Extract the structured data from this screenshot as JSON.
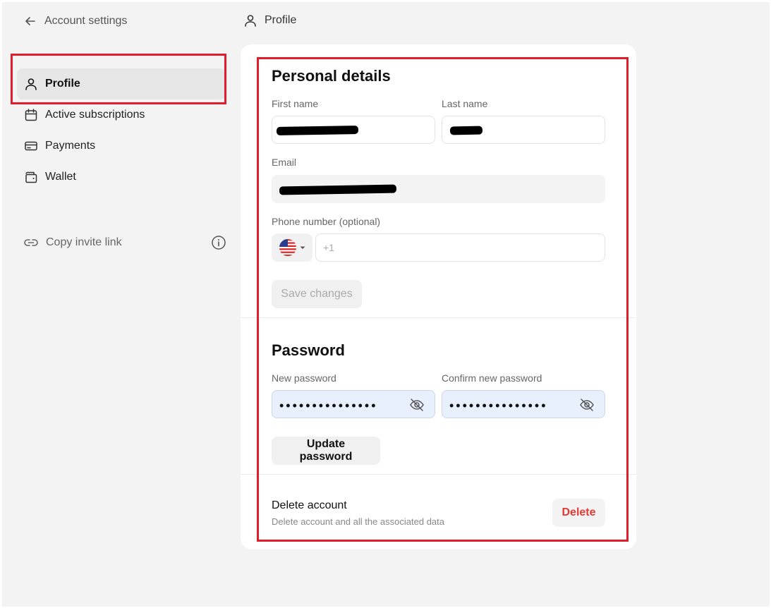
{
  "header": {
    "back_label": "Account settings",
    "breadcrumb": "Profile"
  },
  "sidebar": {
    "items": [
      {
        "label": "Profile",
        "icon": "user-icon",
        "active": true
      },
      {
        "label": "Active subscriptions",
        "icon": "calendar-icon",
        "active": false
      },
      {
        "label": "Payments",
        "icon": "credit-card-icon",
        "active": false
      },
      {
        "label": "Wallet",
        "icon": "wallet-icon",
        "active": false
      }
    ],
    "invite_label": "Copy invite link",
    "invite_icon": "link-icon",
    "info_icon": "info-icon"
  },
  "personal": {
    "title": "Personal details",
    "first_name_label": "First name",
    "last_name_label": "Last name",
    "email_label": "Email",
    "phone_label": "Phone number (optional)",
    "phone_placeholder": "+1",
    "country_flag": "us-flag-icon",
    "save_label": "Save changes"
  },
  "password": {
    "title": "Password",
    "new_label": "New password",
    "confirm_label": "Confirm new password",
    "new_value": "•••••••••••••••",
    "confirm_value": "•••••••••••••••",
    "update_label": "Update password"
  },
  "delete_account": {
    "title": "Delete account",
    "subtitle": "Delete account and all the associated data",
    "button_label": "Delete"
  },
  "colors": {
    "highlight": "#e01e2a",
    "danger": "#e53935",
    "page_bg": "#f3f3f3",
    "password_bg": "#e9f0fd"
  }
}
